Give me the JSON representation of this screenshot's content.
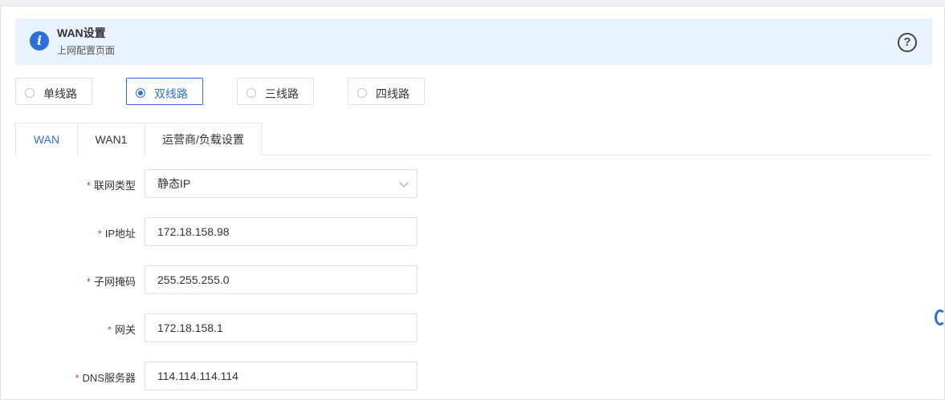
{
  "banner": {
    "title": "WAN设置",
    "subtitle": "上网配置页面",
    "info_icon": "i",
    "help_icon": "?"
  },
  "line_modes": [
    {
      "label": "单线路",
      "selected": false
    },
    {
      "label": "双线路",
      "selected": true
    },
    {
      "label": "三线路",
      "selected": false
    },
    {
      "label": "四线路",
      "selected": false
    }
  ],
  "tabs": [
    {
      "label": "WAN",
      "active": true
    },
    {
      "label": "WAN1",
      "active": false
    },
    {
      "label": "运营商/负载设置",
      "active": false
    }
  ],
  "form": {
    "required_mark": "*",
    "connection_type": {
      "label": "联网类型",
      "value": "静态IP"
    },
    "ip_address": {
      "label": "IP地址",
      "value": "172.18.158.98"
    },
    "subnet_mask": {
      "label": "子网掩码",
      "value": "255.255.255.0"
    },
    "gateway": {
      "label": "网关",
      "value": "172.18.158.1"
    },
    "dns_server": {
      "label": "DNS服务器",
      "value": "114.114.114.114"
    }
  },
  "colors": {
    "accent": "#2d6fd6",
    "banner_bg": "#e8f3fd",
    "required": "#e4393c",
    "border": "#dcdfe6"
  }
}
